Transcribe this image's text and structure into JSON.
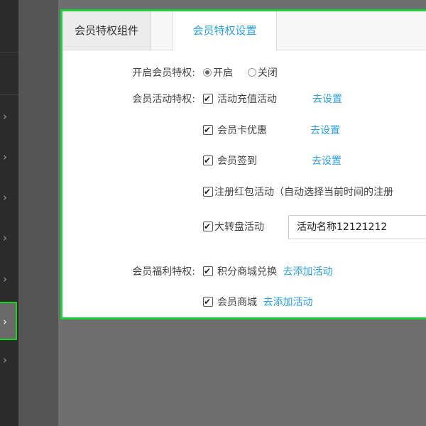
{
  "tabs": [
    {
      "label": "会员特权组件"
    },
    {
      "label": "会员特权设置"
    }
  ],
  "open_privilege": {
    "label": "开启会员特权:",
    "options": [
      {
        "label": "开启",
        "selected": true
      },
      {
        "label": "关闭",
        "selected": false
      }
    ]
  },
  "activity_privilege": {
    "label": "会员活动特权:",
    "items": [
      {
        "label": "活动充值活动",
        "link": "去设置",
        "checked": true
      },
      {
        "label": "会员卡优惠",
        "link": "去设置",
        "checked": true
      },
      {
        "label": "会员签到",
        "link": "去设置",
        "checked": true
      },
      {
        "label": "注册红包活动（自动选择当前时间的注册",
        "checked": true
      },
      {
        "label": "大转盘活动",
        "checked": true,
        "input_value": "活动名称12121212"
      }
    ]
  },
  "welfare_privilege": {
    "label": "会员福利特权:",
    "items": [
      {
        "label": "积分商城兑换",
        "link": "去添加活动",
        "checked": true
      },
      {
        "label": "会员商城",
        "link": "去添加活动",
        "checked": true
      }
    ]
  },
  "colors": {
    "accent": "#2aa0e6",
    "highlight_border": "#1fcf3a",
    "sidebar": "#2b2b2b"
  }
}
